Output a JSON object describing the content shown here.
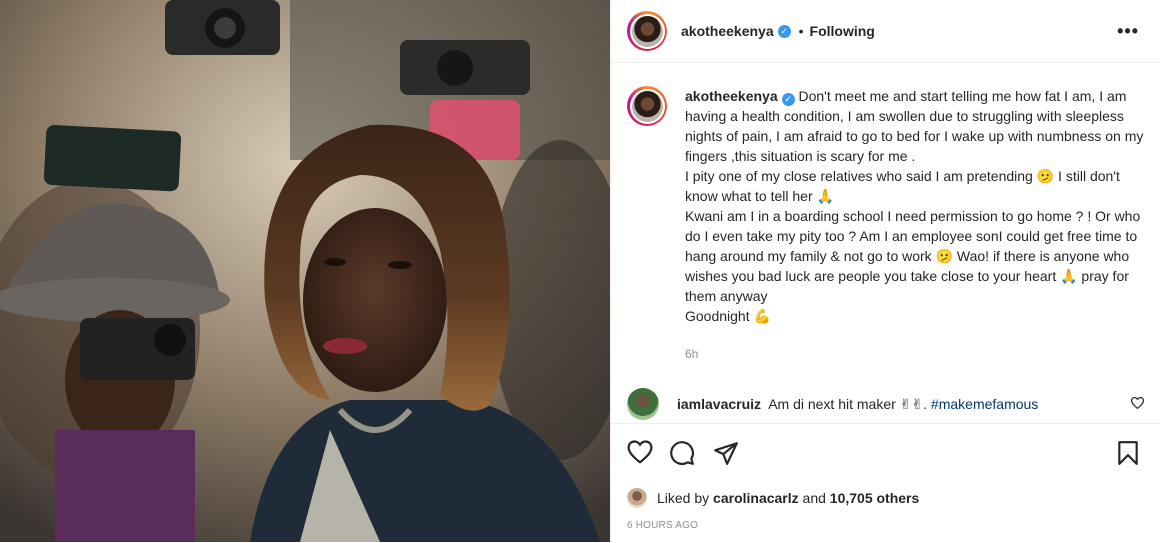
{
  "post": {
    "username": "akotheekenya",
    "separator": "•",
    "follow_state": "Following",
    "caption_username": "akotheekenya",
    "caption_lines": [
      "Don't meet me and start telling me how fat I am, I am having a health condition, I am swollen due to struggling with sleepless nights of pain, I am afraid to go to bed for I wake up with numbness on my fingers ,this situation is scary for me .",
      "I pity one of my close relatives who said I am pretending 🫤 I still don't know what to tell her 🙏",
      "Kwani am I in a boarding school I need permission to go home ? ! Or who do I even take my pity too ? Am I an employee sonI could get free time to hang around my family & not go to work 🫤 Wao! if there is anyone who wishes you bad luck are people you take close to your heart 🙏 pray for them anyway",
      "Goodnight 💪"
    ],
    "caption_time": "6h",
    "comment": {
      "username": "iamlavacruiz",
      "text": "Am di next hit maker ✌✌.",
      "hashtag": "#makemefamous"
    },
    "likes": {
      "prefix": "Liked by",
      "user": "carolinacarlz",
      "middle": "and",
      "count": "10,705 others"
    },
    "age": "6 HOURS AGO"
  },
  "icons": {
    "verified": "verified-badge-icon",
    "more": "more-options-icon",
    "like": "heart-icon",
    "comment": "comment-icon",
    "share": "share-icon",
    "save": "bookmark-icon"
  },
  "colors": {
    "verified": "#3897f0",
    "text": "#262626",
    "muted": "#8e8e8e",
    "hashtag": "#00376b"
  }
}
